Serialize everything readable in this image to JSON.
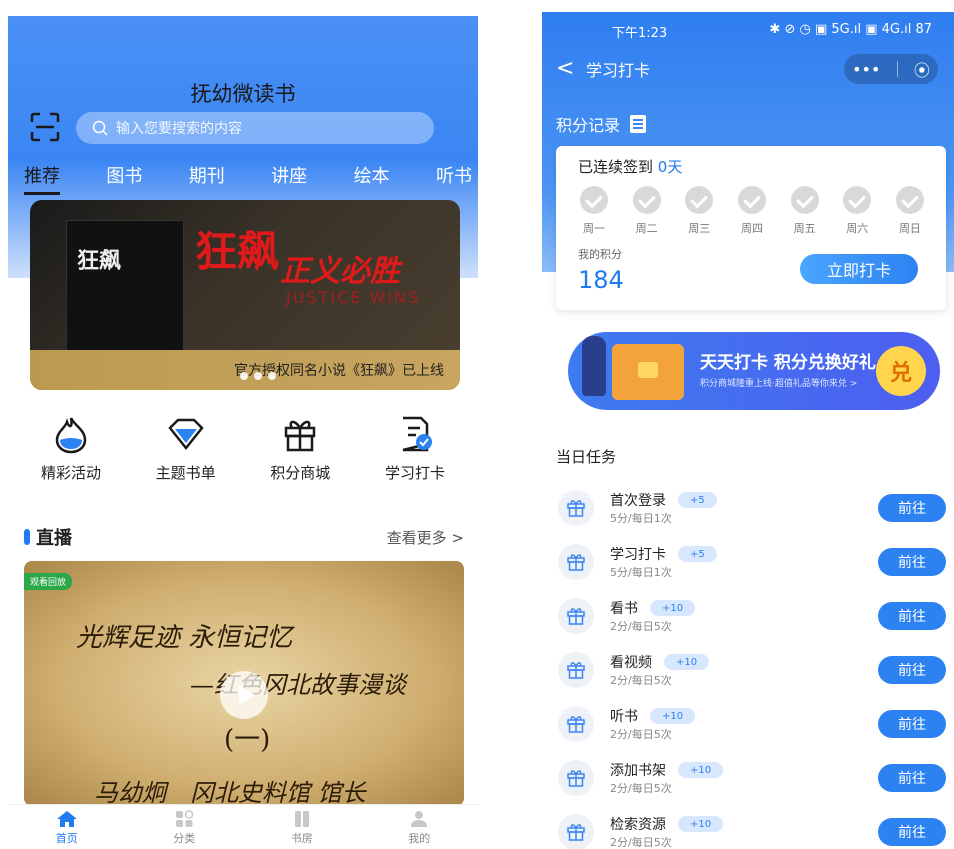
{
  "left": {
    "app_title": "抚幼微读书",
    "search_placeholder": "输入您要搜索的内容",
    "tabs": [
      "推荐",
      "图书",
      "期刊",
      "讲座",
      "绘本",
      "听书"
    ],
    "banner": {
      "book_title": "狂飙",
      "big_title": "狂飙",
      "slogan": "正义必胜",
      "slogan_en": "JUSTICE WINS",
      "caption": "官方授权同名小说《狂飙》已上线",
      "slides": 3
    },
    "quick": [
      {
        "label": "精彩活动",
        "icon": "flame-drop-icon"
      },
      {
        "label": "主题书单",
        "icon": "diamond-icon"
      },
      {
        "label": "积分商城",
        "icon": "gift-icon"
      },
      {
        "label": "学习打卡",
        "icon": "checklist-icon"
      }
    ],
    "live": {
      "title": "直播",
      "more": "查看更多 >",
      "badge": "观看回放",
      "lines": [
        "光辉足迹 永恒记忆",
        "—红色冈北故事漫谈",
        "(一)",
        "马幼炯　冈北史料馆 馆长"
      ]
    },
    "tabbar": [
      {
        "label": "首页",
        "icon": "home-icon",
        "active": true
      },
      {
        "label": "分类",
        "icon": "category-icon",
        "active": false
      },
      {
        "label": "书房",
        "icon": "bookshelf-icon",
        "active": false
      },
      {
        "label": "我的",
        "icon": "user-icon",
        "active": false
      }
    ]
  },
  "right": {
    "status": {
      "time": "下午1:23",
      "icons": "✱ ⊘ ◷ ▣ 5G.ıl ▣ 4G.ıl 87"
    },
    "nav": {
      "back": "<",
      "title": "学习打卡",
      "more": "•••",
      "target": "⦿"
    },
    "points_record": "积分记录",
    "streak_prefix": "已连续签到",
    "streak_value": "0天",
    "days": [
      "周一",
      "周二",
      "周三",
      "周四",
      "周五",
      "周六",
      "周日"
    ],
    "my_points_label": "我的积分",
    "my_points": "184",
    "checkin_label": "立即打卡",
    "promo": {
      "title": "天天打卡 积分兑换好礼",
      "subtitle": "积分商城隆重上线·超值礼品等你来兑 >",
      "badge": "兑"
    },
    "tasks_title": "当日任务",
    "tasks": [
      {
        "name": "首次登录",
        "points": "+5",
        "desc": "5分/每日1次",
        "action": "前往"
      },
      {
        "name": "学习打卡",
        "points": "+5",
        "desc": "5分/每日1次",
        "action": "前往"
      },
      {
        "name": "看书",
        "points": "+10",
        "desc": "2分/每日5次",
        "action": "前往"
      },
      {
        "name": "看视频",
        "points": "+10",
        "desc": "2分/每日5次",
        "action": "前往"
      },
      {
        "name": "听书",
        "points": "+10",
        "desc": "2分/每日5次",
        "action": "前往"
      },
      {
        "name": "添加书架",
        "points": "+10",
        "desc": "2分/每日5次",
        "action": "前往"
      },
      {
        "name": "检索资源",
        "points": "+10",
        "desc": "2分/每日5次",
        "action": "前往"
      }
    ],
    "colors": {
      "accent": "#2d82f1",
      "header": "#3b86f4"
    }
  }
}
